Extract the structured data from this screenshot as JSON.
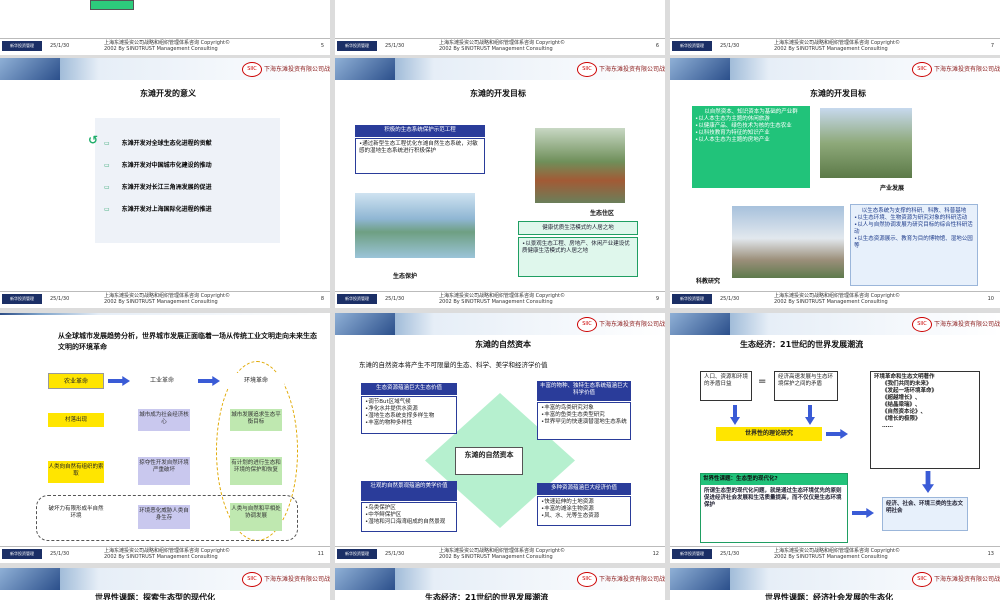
{
  "footer": {
    "logo_text": "新华投资管理",
    "date": "25/1/30",
    "copyright_line1": "上海东滩投资公司战略和组织管理体系咨询 Copyright©",
    "copyright_line2": "2002 By SINOTRUST Management Consulting"
  },
  "header": {
    "emblem": "SIIC",
    "company": "下海东滩投资有限公司战略规划"
  },
  "top_row": {
    "pages": [
      "5",
      "6",
      "7"
    ]
  },
  "s8": {
    "page": "8",
    "title": "东滩开发的意义",
    "items": [
      "东滩开发对全球生态化进程的贡献",
      "东滩开发对中国城市化建设的推动",
      "东滩开发对长江三角洲发展的促进",
      "东滩开发对上海国际化进程的推进"
    ]
  },
  "s9": {
    "page": "9",
    "title": "东滩的开发目标",
    "box1_title": "积极的生态系统保护示范工程",
    "box1_text": "•通过新型生态工程优化东滩自然生态系统，对敏感的湿地生态系统进行积极保护",
    "cap_protect": "生态保护",
    "cap_live": "生态住区",
    "box2_title": "健康优质生活模式的人居之地",
    "box2_text": "•以景观生态工程、房地产、休闲产业建设优质健康生活模式的人居之地"
  },
  "s10": {
    "page": "10",
    "title": "东滩的开发目标",
    "green_text": [
      "以自然资本、知识资本为基础的产业群",
      "•以人本生态为主题的休闲旅游",
      "•以健康产品、绿色技术为核的生态农业",
      "•以科技教育为特征的知识产业",
      "•以人本生态为主题的房地产业"
    ],
    "cap_industry": "产业发展",
    "right_title": "以生态系统为支撑的科研、科教、科普基地",
    "right_text": [
      "•以生态环境、生物资源为研究对象的科研活动",
      "•以人与自然协调发展为研究目标的综合性科研活动",
      "•以生态资源展示、教育为目的博物馆、湿地公园等"
    ],
    "cap_research": "科教研究"
  },
  "s11": {
    "page": "11",
    "headline": "从全球城市发展趋势分析，世界城市发展正面临着一场从传统工业文明走向未来生态文明的环境革命",
    "col1": [
      "农业革命",
      "村落出现",
      "人类向自然有组织的索取",
      "破坏力有限形成半自然环境"
    ],
    "col2": [
      "工业革命",
      "城市成为社会经济核心",
      "掠夺性开发自然环境严重破坏",
      "环境恶化威胁人类自身生存"
    ],
    "col3": [
      "环境革命",
      "城市发展追求生态平衡目标",
      "有计划的进行生态和环境的保护和恢复",
      "人类与自然和平相处协调发展"
    ]
  },
  "s12": {
    "page": "12",
    "title": "东滩的自然资本",
    "subtitle": "东滩的自然资本将产生不可限量的生态、科学、美学和经济学价值",
    "center": "东滩的自然资本",
    "q1_title": "生态资源蕴涵巨大生态价值",
    "q1_items": [
      "•调节But区域气候",
      "•净化水并提供水资源",
      "•湿地生态系统支撑多样生物",
      "•丰富的物种多样性"
    ],
    "q2_title": "丰富的物种、独特生态系统蕴涵巨大科学价值",
    "q2_items": [
      "•丰富的鸟类研究对象",
      "•丰富的鱼类生态类型研究",
      "•世界罕见的快速演替湿地生态系统"
    ],
    "q3_title": "壮观的自然景观蕴涵的美学价值",
    "q3_items": [
      "•鸟类保护区",
      "•中华鲟保护区",
      "•湿地和河口海湾组成的自然景观"
    ],
    "q4_title": "多种资源蕴涵巨大经济价值",
    "q4_items": [
      "•快速延伸的土地资源",
      "•丰富的滩涂生物资源",
      "•风、水、光等生态资源"
    ]
  },
  "s13": {
    "page": "13",
    "title": "生态经济：21世纪的世界发展潮流",
    "box_a": "人口、资源和环境的矛盾日益",
    "eq": "=",
    "box_b": "经济高速发展与生态环境保护之间的矛盾",
    "theory": "世界性的理论研究",
    "books_title": "环境革命和生态文明著作",
    "books": [
      "《我们共同的未来》",
      "《发起一场环境革命》",
      "《超越增长》、",
      "《结晶梁瑞》、",
      "《自然资本论》、",
      "《增长的极限》",
      "……"
    ],
    "q_title": "世界性课题：生态型的现代化?",
    "q_text": "所谓生态型的现代化问题，就是通过生态环境优先的原则促进经济社会发展和生活质量提高，而不仅仅是生态环境保护",
    "result": "经济、社会、环境三类的生态文明社会"
  },
  "bottom_row": {
    "t1": "世界性课题：探索生态型的现代化",
    "t2": "生态经济：21世纪的世界发展潮流",
    "t3": "世界性课题：经济社会发展的生态化"
  }
}
